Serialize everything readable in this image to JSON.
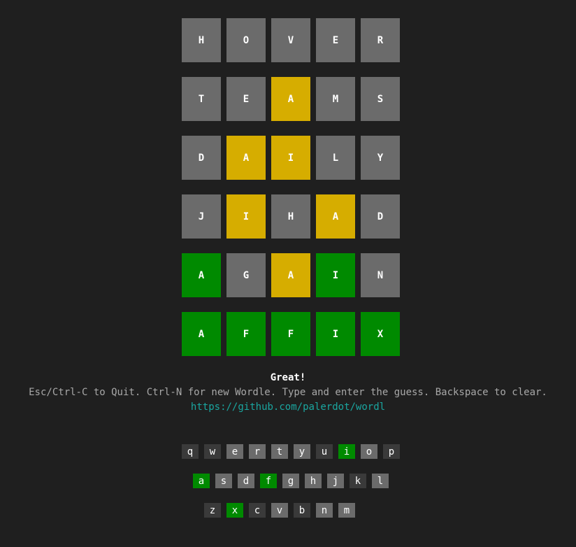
{
  "colors": {
    "background": "#1f1f1f",
    "absent": "#6b6b6b",
    "present": "#d6ad00",
    "correct": "#008a00",
    "unused_key": "#3a3a3a",
    "link": "#1aa6a0"
  },
  "board": [
    [
      {
        "letter": "H",
        "state": "gray"
      },
      {
        "letter": "O",
        "state": "gray"
      },
      {
        "letter": "V",
        "state": "gray"
      },
      {
        "letter": "E",
        "state": "gray"
      },
      {
        "letter": "R",
        "state": "gray"
      }
    ],
    [
      {
        "letter": "T",
        "state": "gray"
      },
      {
        "letter": "E",
        "state": "gray"
      },
      {
        "letter": "A",
        "state": "yellow"
      },
      {
        "letter": "M",
        "state": "gray"
      },
      {
        "letter": "S",
        "state": "gray"
      }
    ],
    [
      {
        "letter": "D",
        "state": "gray"
      },
      {
        "letter": "A",
        "state": "yellow"
      },
      {
        "letter": "I",
        "state": "yellow"
      },
      {
        "letter": "L",
        "state": "gray"
      },
      {
        "letter": "Y",
        "state": "gray"
      }
    ],
    [
      {
        "letter": "J",
        "state": "gray"
      },
      {
        "letter": "I",
        "state": "yellow"
      },
      {
        "letter": "H",
        "state": "gray"
      },
      {
        "letter": "A",
        "state": "yellow"
      },
      {
        "letter": "D",
        "state": "gray"
      }
    ],
    [
      {
        "letter": "A",
        "state": "green"
      },
      {
        "letter": "G",
        "state": "gray"
      },
      {
        "letter": "A",
        "state": "yellow"
      },
      {
        "letter": "I",
        "state": "green"
      },
      {
        "letter": "N",
        "state": "gray"
      }
    ],
    [
      {
        "letter": "A",
        "state": "green"
      },
      {
        "letter": "F",
        "state": "green"
      },
      {
        "letter": "F",
        "state": "green"
      },
      {
        "letter": "I",
        "state": "green"
      },
      {
        "letter": "X",
        "state": "green"
      }
    ]
  ],
  "messages": {
    "status": "Great!",
    "help": "Esc/Ctrl-C to Quit. Ctrl-N for new Wordle. Type and enter the guess. Backspace to clear.",
    "link": "https://github.com/palerdot/wordl"
  },
  "keyboard": [
    [
      {
        "key": "q",
        "state": "dark"
      },
      {
        "key": "w",
        "state": "dark"
      },
      {
        "key": "e",
        "state": "gray"
      },
      {
        "key": "r",
        "state": "gray"
      },
      {
        "key": "t",
        "state": "gray"
      },
      {
        "key": "y",
        "state": "gray"
      },
      {
        "key": "u",
        "state": "dark"
      },
      {
        "key": "i",
        "state": "green"
      },
      {
        "key": "o",
        "state": "gray"
      },
      {
        "key": "p",
        "state": "dark"
      }
    ],
    [
      {
        "key": "a",
        "state": "green"
      },
      {
        "key": "s",
        "state": "gray"
      },
      {
        "key": "d",
        "state": "gray"
      },
      {
        "key": "f",
        "state": "green"
      },
      {
        "key": "g",
        "state": "gray"
      },
      {
        "key": "h",
        "state": "gray"
      },
      {
        "key": "j",
        "state": "gray"
      },
      {
        "key": "k",
        "state": "dark"
      },
      {
        "key": "l",
        "state": "gray"
      }
    ],
    [
      {
        "key": "z",
        "state": "dark"
      },
      {
        "key": "x",
        "state": "green"
      },
      {
        "key": "c",
        "state": "dark"
      },
      {
        "key": "v",
        "state": "gray"
      },
      {
        "key": "b",
        "state": "dark"
      },
      {
        "key": "n",
        "state": "gray"
      },
      {
        "key": "m",
        "state": "gray"
      }
    ]
  ]
}
